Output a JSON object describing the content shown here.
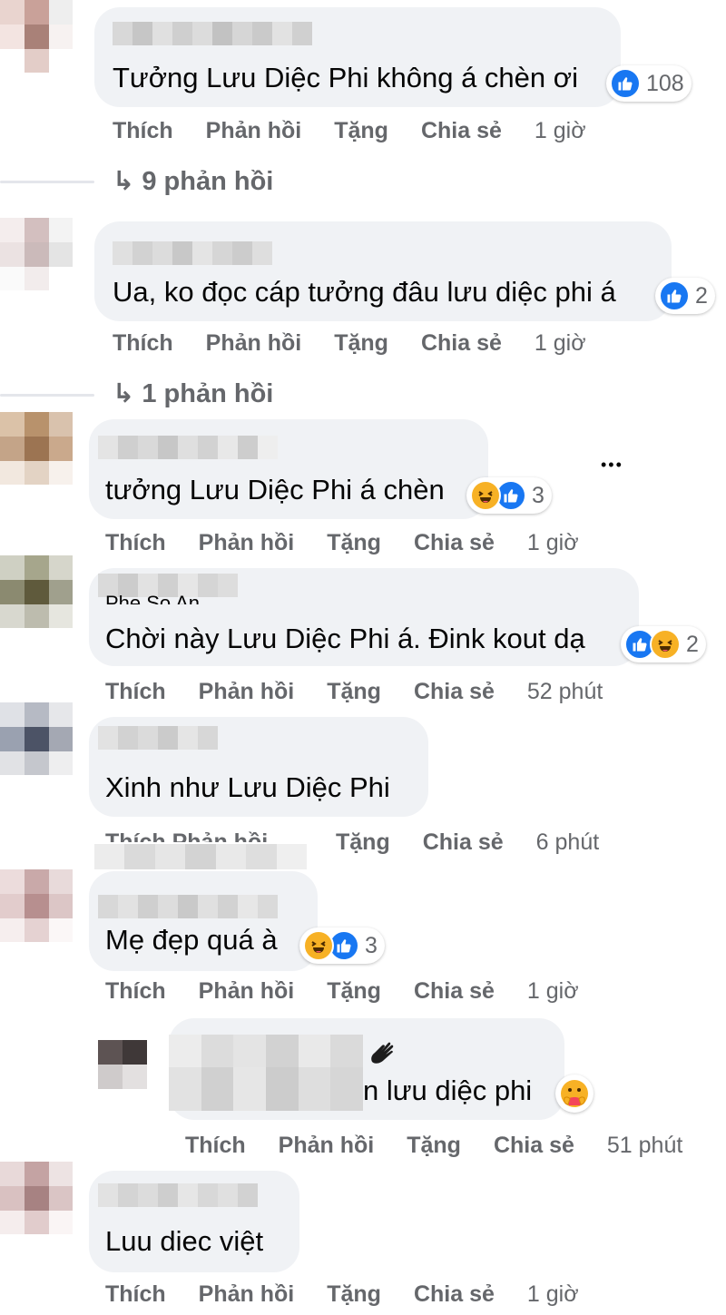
{
  "actions": {
    "like": "Thích",
    "reply": "Phản hồi",
    "gift": "Tặng",
    "share": "Chia sẻ"
  },
  "comments": [
    {
      "text": "Tưởng Lưu Diệc Phi không á chèn ơi",
      "reaction_count": "108",
      "time": "1 giờ",
      "replies": "9 phản hồi"
    },
    {
      "text": "Ua, ko đọc cáp tưởng đâu lưu diệc phi á",
      "reaction_count": "2",
      "time": "1 giờ",
      "replies": "1 phản hồi"
    },
    {
      "text": "tưởng Lưu Diệc Phi á chèn",
      "reaction_count": "3",
      "time": "1 giờ",
      "more": "•••"
    },
    {
      "name_partial": "Phe So An",
      "text": "Chời này Lưu Diệc Phi á. Đink kout dạ",
      "reaction_count": "2",
      "time": "52 phút"
    },
    {
      "text": "Xinh như Lưu Diệc Phi",
      "time": "6 phút",
      "partial_actions": "Thích Phản hồi"
    },
    {
      "text": "Mẹ đẹp quá à",
      "reaction_count": "3",
      "time": "1 giờ"
    },
    {
      "text": "n lưu diệc phi",
      "time": "51 phút"
    },
    {
      "text": "Luu diec việt",
      "time": "1 giờ"
    }
  ],
  "colors": {
    "bubble": "#f0f2f5",
    "secondary_text": "#65676b",
    "like_blue": "#1877f2",
    "haha_yellow": "#f7b125"
  },
  "icons": [
    "like-icon",
    "haha-icon",
    "care-icon",
    "wave-icon",
    "reply-arrow-icon",
    "more-dots-icon"
  ]
}
